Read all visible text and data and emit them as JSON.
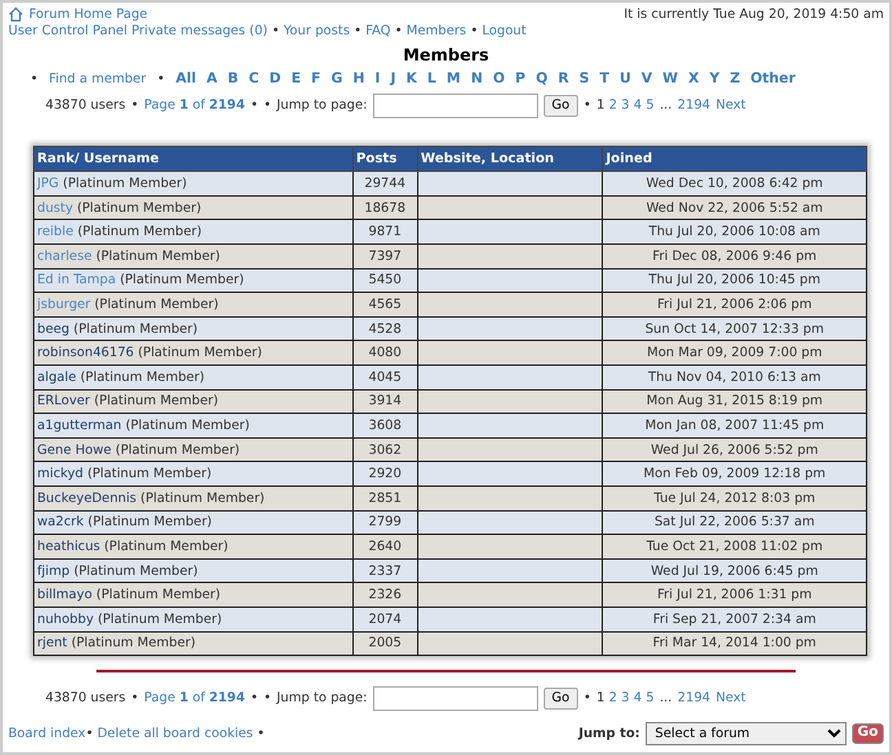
{
  "header": {
    "separator": "•",
    "home_link": "Forum Home Page",
    "current_time": "It is currently Tue Aug 20, 2019 4:50 am",
    "nav": [
      "User Control Panel",
      "Private messages (0)",
      "Your posts",
      "FAQ",
      "Members",
      "Logout"
    ]
  },
  "title": "Members",
  "filter": {
    "separator": "•",
    "find_link": "Find a member",
    "letters": [
      "All",
      "A",
      "B",
      "C",
      "D",
      "E",
      "F",
      "G",
      "H",
      "I",
      "J",
      "K",
      "L",
      "M",
      "N",
      "O",
      "P",
      "Q",
      "R",
      "S",
      "T",
      "U",
      "V",
      "W",
      "X",
      "Y",
      "Z",
      "Other"
    ]
  },
  "pagination_top": {
    "separator": "•",
    "count": "43870 users",
    "page_of": "Page **1** of **2194**",
    "jump_label": "Jump to page:",
    "go": "Go",
    "pages": [
      {
        "label": "1",
        "selected": true
      },
      {
        "label": "2",
        "selected": false
      },
      {
        "label": "3",
        "selected": false
      },
      {
        "label": "4",
        "selected": false
      },
      {
        "label": "5",
        "selected": false
      }
    ],
    "ellipsis": "...",
    "last": "2194",
    "next": "Next"
  },
  "table": {
    "columns": [
      "Rank/ Username",
      "Posts",
      "Website, Location",
      "Joined"
    ],
    "rows": [
      {
        "name": "JPG",
        "color": "#4a86c5",
        "rank": "(Platinum Member)",
        "posts": "29744",
        "joined": "Wed Dec 10, 2008 6:42 pm"
      },
      {
        "name": "dusty",
        "color": "#4a86c5",
        "rank": "(Platinum Member)",
        "posts": "18678",
        "joined": "Wed Nov 22, 2006 5:52 am"
      },
      {
        "name": "reible",
        "color": "#4a86c5",
        "rank": "(Platinum Member)",
        "posts": "9871",
        "joined": "Thu Jul 20, 2006 10:08 am"
      },
      {
        "name": "charlese",
        "color": "#4a86c5",
        "rank": "(Platinum Member)",
        "posts": "7397",
        "joined": "Fri Dec 08, 2006 9:46 pm"
      },
      {
        "name": "Ed in Tampa",
        "color": "#4a86c5",
        "rank": "(Platinum Member)",
        "posts": "5450",
        "joined": "Thu Jul 20, 2006 10:45 pm"
      },
      {
        "name": "jsburger",
        "color": "#4a86c5",
        "rank": "(Platinum Member)",
        "posts": "4565",
        "joined": "Fri Jul 21, 2006 2:06 pm"
      },
      {
        "name": "beeg",
        "color": "#1f3f6e",
        "rank": "(Platinum Member)",
        "posts": "4528",
        "joined": "Sun Oct 14, 2007 12:33 pm"
      },
      {
        "name": "robinson46176",
        "color": "#1f3f6e",
        "rank": "(Platinum Member)",
        "posts": "4080",
        "joined": "Mon Mar 09, 2009 7:00 pm"
      },
      {
        "name": "algale",
        "color": "#1f3f6e",
        "rank": "(Platinum Member)",
        "posts": "4045",
        "joined": "Thu Nov 04, 2010 6:13 am"
      },
      {
        "name": "ERLover",
        "color": "#1f3f6e",
        "rank": "(Platinum Member)",
        "posts": "3914",
        "joined": "Mon Aug 31, 2015 8:19 pm"
      },
      {
        "name": "a1gutterman",
        "color": "#1f3f6e",
        "rank": "(Platinum Member)",
        "posts": "3608",
        "joined": "Mon Jan 08, 2007 11:45 pm"
      },
      {
        "name": "Gene Howe",
        "color": "#1f3f6e",
        "rank": "(Platinum Member)",
        "posts": "3062",
        "joined": "Wed Jul 26, 2006 5:52 pm"
      },
      {
        "name": "mickyd",
        "color": "#1f3f6e",
        "rank": "(Platinum Member)",
        "posts": "2920",
        "joined": "Mon Feb 09, 2009 12:18 pm"
      },
      {
        "name": "BuckeyeDennis",
        "color": "#1f3f6e",
        "rank": "(Platinum Member)",
        "posts": "2851",
        "joined": "Tue Jul 24, 2012 8:03 pm"
      },
      {
        "name": "wa2crk",
        "color": "#1f3f6e",
        "rank": "(Platinum Member)",
        "posts": "2799",
        "joined": "Sat Jul 22, 2006 5:37 am"
      },
      {
        "name": "heathicus",
        "color": "#1f3f6e",
        "rank": "(Platinum Member)",
        "posts": "2640",
        "joined": "Tue Oct 21, 2008 11:02 pm"
      },
      {
        "name": "fjimp",
        "color": "#1f3f6e",
        "rank": "(Platinum Member)",
        "posts": "2337",
        "joined": "Wed Jul 19, 2006 6:45 pm"
      },
      {
        "name": "billmayo",
        "color": "#1f3f6e",
        "rank": "(Platinum Member)",
        "posts": "2326",
        "joined": "Fri Jul 21, 2006 1:31 pm"
      },
      {
        "name": "nuhobby",
        "color": "#1f3f6e",
        "rank": "(Platinum Member)",
        "posts": "2074",
        "joined": "Fri Sep 21, 2007 2:34 am"
      },
      {
        "name": "rjent",
        "color": "#1f3f6e",
        "rank": "(Platinum Member)",
        "posts": "2005",
        "joined": "Fri Mar 14, 2014 1:00 pm"
      }
    ]
  },
  "pagination_bottom": {
    "separator": "•",
    "count": "43870 users",
    "page_of": "Page **1** of **2194**",
    "jump_label": "Jump to page:",
    "go": "Go",
    "pages": [
      {
        "label": "1",
        "selected": true
      },
      {
        "label": "2",
        "selected": false
      },
      {
        "label": "3",
        "selected": false
      },
      {
        "label": "4",
        "selected": false
      },
      {
        "label": "5",
        "selected": false
      }
    ],
    "ellipsis": "...",
    "last": "2194",
    "next": "Next"
  },
  "footer": {
    "separator": "•",
    "links": [
      "Board index",
      "Delete all board cookies"
    ],
    "jump_label": "Jump to:",
    "forum_select": "Select a forum",
    "go": "Go"
  }
}
